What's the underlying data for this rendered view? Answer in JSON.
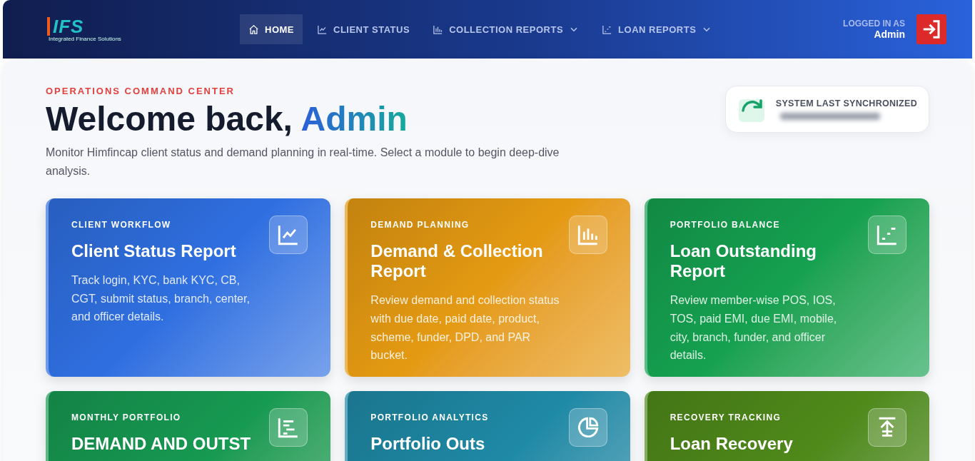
{
  "header": {
    "logo": {
      "letters": "IFS",
      "tagline": "Integrated Finance Solutions"
    },
    "nav": [
      {
        "label": "HOME",
        "kind": "home",
        "selected": true,
        "dropdown": false
      },
      {
        "label": "CLIENT STATUS",
        "kind": "line",
        "selected": false,
        "dropdown": false
      },
      {
        "label": "COLLECTION REPORTS",
        "kind": "bars",
        "selected": false,
        "dropdown": true
      },
      {
        "label": "LOAN REPORTS",
        "kind": "scatter",
        "selected": false,
        "dropdown": true
      }
    ],
    "user": {
      "caption": "LOGGED IN AS",
      "name": "Admin"
    }
  },
  "hero": {
    "eyebrow": "OPERATIONS COMMAND CENTER",
    "greeting": "Welcome back,",
    "name": "Admin",
    "description": "Monitor Himfincap client status and demand planning in real-time. Select a module to begin deep-dive analysis."
  },
  "sync": {
    "label": "SYSTEM LAST SYNCHRONIZED"
  },
  "cards": [
    {
      "kicker": "CLIENT WORKFLOW",
      "title": "Client Status Report",
      "description": "Track login, KYC, bank KYC, CB, CGT, submit status, branch, center, and officer details.",
      "color": "#2f6fe0",
      "kind": "line"
    },
    {
      "kicker": "DEMAND PLANNING",
      "title": "Demand & Collection Report",
      "description": "Review demand and collection status with due date, paid date, product, scheme, funder, DPD, and PAR bucket.",
      "color": "#e59a12",
      "kind": "bars"
    },
    {
      "kicker": "PORTFOLIO BALANCE",
      "title": "Loan Outstanding Report",
      "description": "Review member-wise POS, IOS, TOS, paid EMI, due EMI, mobile, city, branch, funder, and officer details.",
      "color": "#15a150",
      "kind": "scatter"
    },
    {
      "kicker": "MONTHLY PORTFOLIO",
      "title": "DEMAND AND OUTST",
      "color": "#179a52",
      "kind": "list"
    },
    {
      "kicker": "PORTFOLIO ANALYTICS",
      "title": "Portfolio Outs",
      "color": "#1f8aa6",
      "kind": "pie"
    },
    {
      "kicker": "RECOVERY TRACKING",
      "title": "Loan Recovery",
      "color": "#4f8a1a",
      "kind": "upload"
    }
  ]
}
